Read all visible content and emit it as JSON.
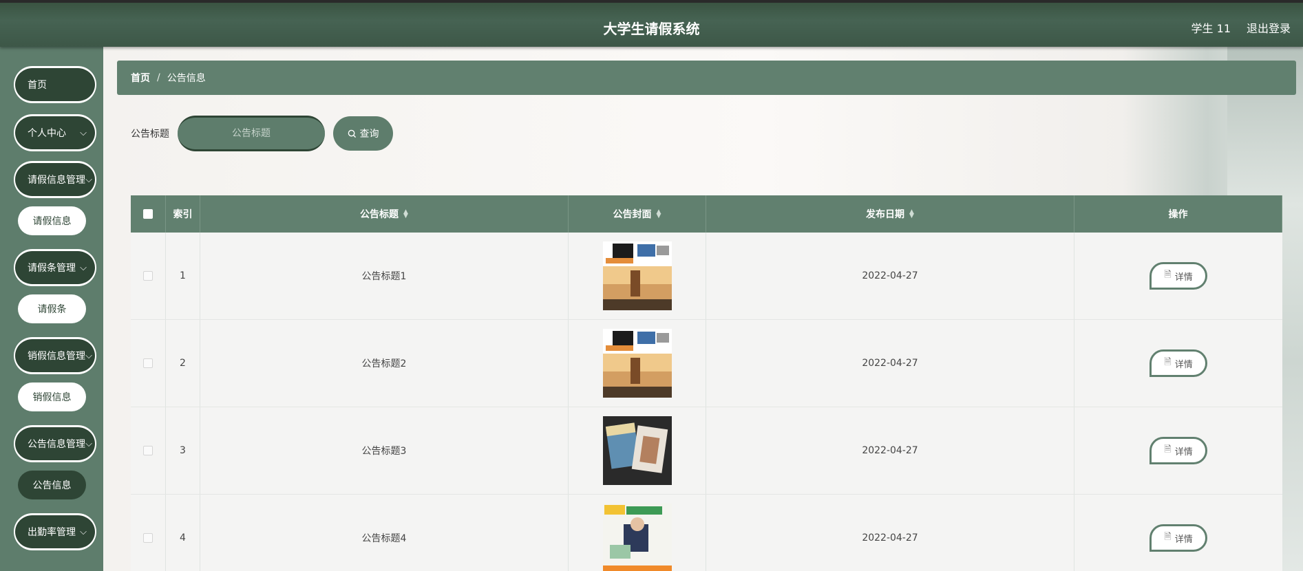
{
  "header": {
    "title": "大学生请假系统",
    "user": "学生 11",
    "logout": "退出登录"
  },
  "sidebar": {
    "items": [
      {
        "label": "首页",
        "type": "group",
        "chevron": false
      },
      {
        "label": "个人中心",
        "type": "group",
        "chevron": true
      },
      {
        "label": "请假信息管理",
        "type": "group",
        "chevron": true
      },
      {
        "label": "请假信息",
        "type": "sub"
      },
      {
        "label": "请假条管理",
        "type": "group",
        "chevron": true
      },
      {
        "label": "请假条",
        "type": "sub"
      },
      {
        "label": "销假信息管理",
        "type": "group",
        "chevron": true
      },
      {
        "label": "销假信息",
        "type": "sub"
      },
      {
        "label": "公告信息管理",
        "type": "group",
        "chevron": true
      },
      {
        "label": "公告信息",
        "type": "sub",
        "active": true
      },
      {
        "label": "出勤率管理",
        "type": "group",
        "chevron": true
      }
    ]
  },
  "breadcrumb": {
    "home": "首页",
    "separator": "/",
    "current": "公告信息"
  },
  "search": {
    "label": "公告标题",
    "placeholder": "公告标题",
    "button": "查询"
  },
  "table": {
    "headers": {
      "index": "索引",
      "title": "公告标题",
      "cover": "公告封面",
      "date": "发布日期",
      "op": "操作"
    },
    "rows": [
      {
        "index": "1",
        "title": "公告标题1",
        "date": "2022-04-27",
        "action": "详情",
        "cover": "magazine-cover-geyan"
      },
      {
        "index": "2",
        "title": "公告标题2",
        "date": "2022-04-27",
        "action": "详情",
        "cover": "magazine-cover-geyan"
      },
      {
        "index": "3",
        "title": "公告标题3",
        "date": "2022-04-27",
        "action": "详情",
        "cover": "magazine-cover-dark"
      },
      {
        "index": "4",
        "title": "公告标题4",
        "date": "2022-04-27",
        "action": "详情",
        "cover": "magazine-cover-aigirl"
      }
    ]
  },
  "colors": {
    "header_bg": "#466353",
    "sidebar_bg": "#5e7d6c",
    "dark_green": "#2e4535",
    "accent": "#61806f"
  }
}
